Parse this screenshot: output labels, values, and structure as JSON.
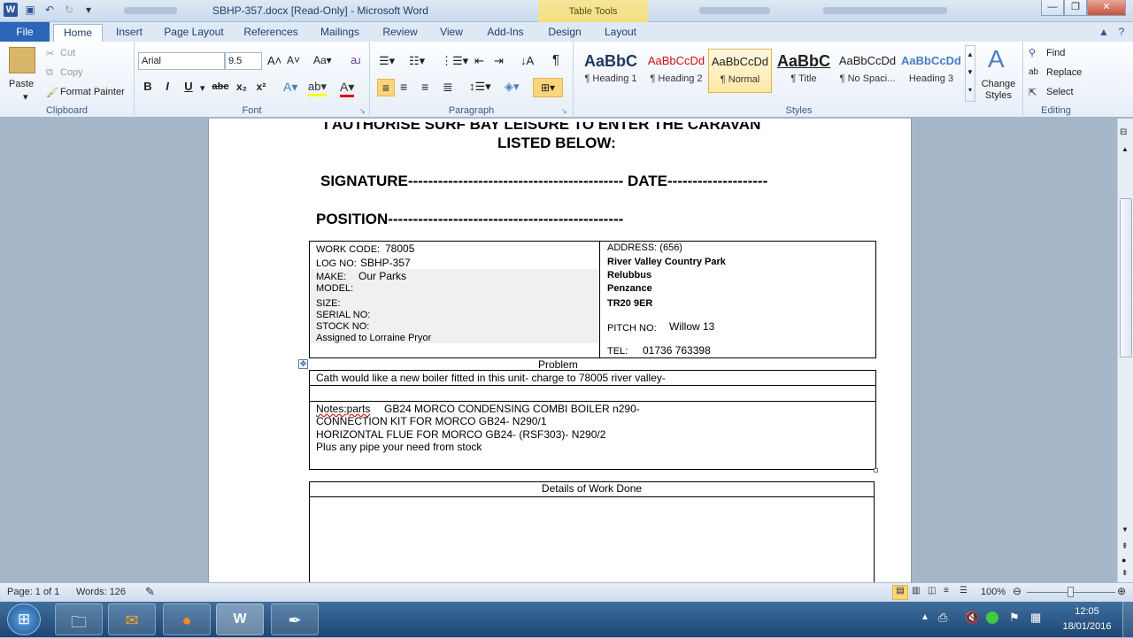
{
  "window": {
    "title": "SBHP-357.docx [Read-Only] - Microsoft Word",
    "context_tab_group": "Table Tools"
  },
  "tabs": [
    "File",
    "Home",
    "Insert",
    "Page Layout",
    "References",
    "Mailings",
    "Review",
    "View",
    "Add-Ins",
    "Design",
    "Layout"
  ],
  "clipboard": {
    "paste": "Paste",
    "cut": "Cut",
    "copy": "Copy",
    "format_painter": "Format Painter",
    "label": "Clipboard"
  },
  "font": {
    "name": "Arial",
    "size": "9.5",
    "label": "Font",
    "bold": "B",
    "italic": "I",
    "underline": "U",
    "strike": "abc",
    "sub": "x₂",
    "sup": "x²"
  },
  "paragraph": {
    "label": "Paragraph"
  },
  "styles": {
    "items": [
      {
        "preview": "AaBbC",
        "name": "¶ Heading 1"
      },
      {
        "preview": "AaBbCcDd",
        "name": "¶ Heading 2"
      },
      {
        "preview": "AaBbCcDd",
        "name": "¶ Normal"
      },
      {
        "preview": "AaBbC",
        "name": "¶ Title"
      },
      {
        "preview": "AaBbCcDd",
        "name": "¶ No Spaci..."
      },
      {
        "preview": "AaBbCcDd",
        "name": "Heading 3"
      }
    ],
    "change": "Change Styles",
    "label": "Styles"
  },
  "editing": {
    "find": "Find",
    "replace": "Replace",
    "select": "Select",
    "label": "Editing"
  },
  "document": {
    "line1": "I AUTHORISE SURF BAY LEISURE TO ENTER THE CARAVAN",
    "line2": "LISTED BELOW:",
    "signature": "SIGNATURE------------------------------------------- DATE--------------------",
    "position": "POSITION-----------------------------------------------",
    "left": {
      "work_code_label": "WORK CODE:",
      "work_code": "78005",
      "log_no_label": "LOG NO:",
      "log_no": "SBHP-357",
      "make_label": "MAKE:",
      "make": "Our Parks",
      "model_label": "MODEL:",
      "size_label": "SIZE:",
      "serial_label": "SERIAL  NO:",
      "stock_label": "STOCK NO:",
      "assigned": "Assigned to Lorraine Pryor"
    },
    "right": {
      "address_label": "ADDRESS:  (656)",
      "addr1": "River Valley Country Park",
      "addr2": "Relubbus",
      "addr3": "Penzance",
      "addr4": "TR20 9ER",
      "pitch_label": "PITCH NO:",
      "pitch": "Willow 13",
      "tel_label": "TEL:",
      "tel": "01736 763398"
    },
    "problem_header": "Problem",
    "problem_text": "Cath would like a new boiler fitted in this unit- charge to 78005 river valley-",
    "notes_label": "Notes:parts",
    "notes1": "GB24 MORCO CONDENSING COMBI BOILER n290-",
    "notes2": "CONNECTION KIT FOR MORCO GB24-  N290/1",
    "notes3": "HORIZONTAL FLUE FOR MORCO GB24- (RSF303)- N290/2",
    "notes4": "Plus any pipe your need from stock",
    "details_header": "Details of Work Done"
  },
  "status": {
    "page": "Page: 1 of 1",
    "words": "Words: 126",
    "zoom": "100%"
  },
  "clock": {
    "time": "12:05",
    "date": "18/01/2016"
  }
}
